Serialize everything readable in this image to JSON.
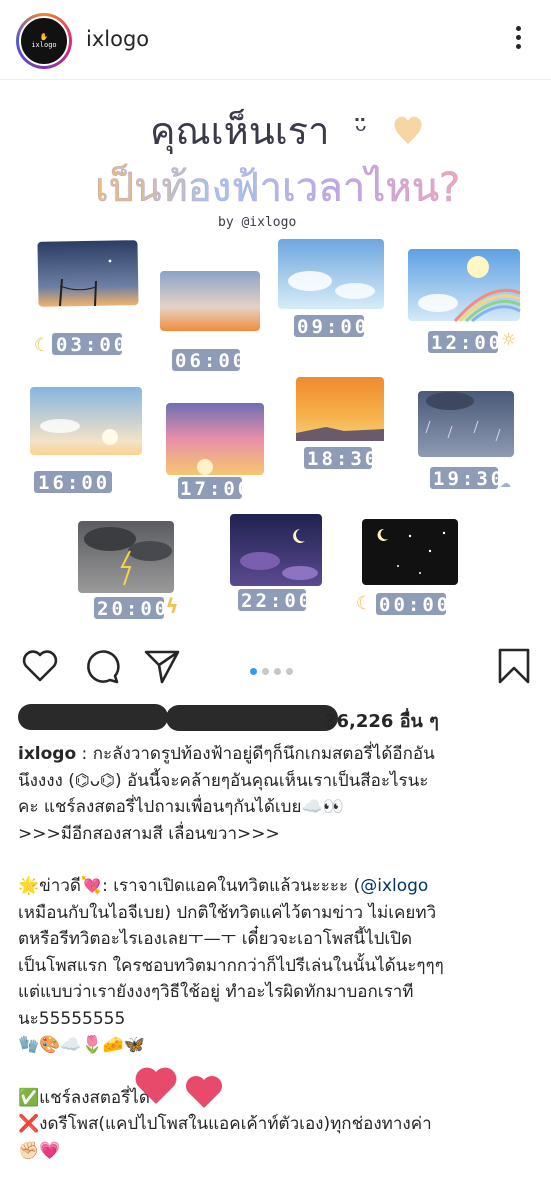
{
  "header": {
    "username": "ixlogo",
    "avatar_text": "ixlogo"
  },
  "image": {
    "title_line1": "คุณเห็นเรา",
    "title_line2": "เป็นท้องฟ้าเวลาไหน?",
    "byline": "by @ixlogo",
    "tiles": [
      {
        "time": "03:00",
        "sky": "night-dusk"
      },
      {
        "time": "06:00",
        "sky": "dawn"
      },
      {
        "time": "09:00",
        "sky": "morning"
      },
      {
        "time": "12:00",
        "sky": "noon-rainbow"
      },
      {
        "time": "16:00",
        "sky": "afternoon"
      },
      {
        "time": "17:00",
        "sky": "sunset-pink"
      },
      {
        "time": "18:30",
        "sky": "sunset-orange"
      },
      {
        "time": "19:30",
        "sky": "rain"
      },
      {
        "time": "20:00",
        "sky": "storm"
      },
      {
        "time": "22:00",
        "sky": "night-purple"
      },
      {
        "time": "00:00",
        "sky": "midnight"
      }
    ]
  },
  "carousel": {
    "total": 4,
    "active": 0
  },
  "likes": {
    "count_text": "36,226 อื่น ๆ"
  },
  "caption": {
    "username": "ixlogo",
    "p1_l1": " : กะลังวาดรูปท้องฟ้าอยู่ดีๆก็นึกเกมสตอรี่ได้อีกอัน",
    "p1_l2": "นึงงงง (⌬ᴗ⌬) อันนี้จะคล้ายๆอันคุณเห็นเราเป็นสีอะไรนะ",
    "p1_l3": "คะ แชร์ลงสตอรี่ไปถามเพื่อนๆกันได้เบย☁️👀",
    "p1_l4": ">>>มีอีกสองสามสี เลื่อนขวา>>>",
    "p2_l1_a": "🌟ข่าวดี💘: เราจาเปิดแอคในทวิตแล้วนะะะะ (",
    "p2_l1_mention": "@ixlogo",
    "p2_l2": "เหมือนกับในไอจีเบย) ปกติใช้ทวิตแค่ไว้ตามข่าว ไม่เคยทวิ",
    "p2_l3": "ตหรือรีทวิตอะไรเองเลยㅜ—ㅜ เดี๋ยวจะเอาโพสนี้ไปเปิด",
    "p2_l4": "เป็นโพสแรก ใครชอบทวิตมากกว่าก็ไปรีเล่นในนั้นได้นะๆๆๆ",
    "p2_l5": "แต่แบบว่าเรายังงงๆวิธีใช้อยู่ ทำอะไรผิดทักมาบอกเราที",
    "p2_l6": "นะ55555555",
    "p2_l7": "🧤🎨☁️🌷🧀🦋",
    "p3_l1": "✅แชร์ลงสตอรี่ได้",
    "p3_l2": "❌งดรีโพส(แคปไปโพสในแอคเค้าท์ตัวเอง)ทุกช่องทางค่า",
    "p3_l3": "✊🏻💗"
  },
  "colors": {
    "like_heart": "#e84a6c",
    "dot_active": "#3897f0",
    "mention": "#003569",
    "digit_card": "#8f9cb8"
  }
}
